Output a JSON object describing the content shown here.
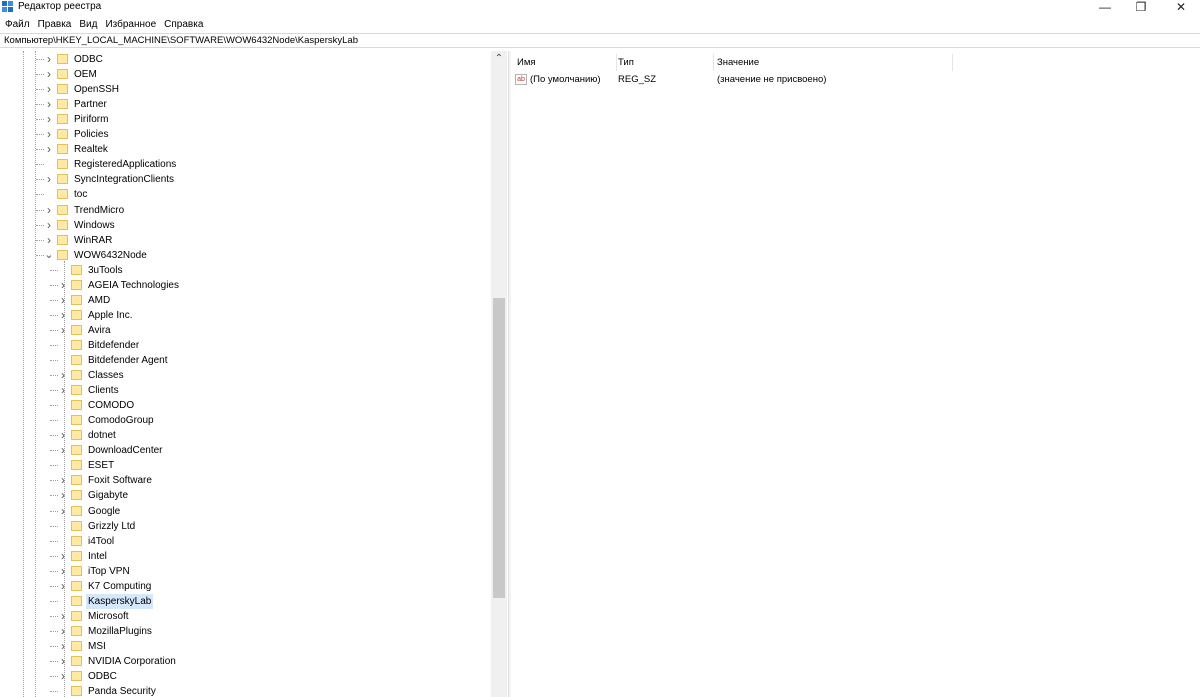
{
  "window": {
    "title": "Редактор реестра",
    "minimize_glyph": "—",
    "restore_glyph": "❐",
    "close_glyph": "✕"
  },
  "menu": [
    "Файл",
    "Правка",
    "Вид",
    "Избранное",
    "Справка"
  ],
  "address": "Компьютер\\HKEY_LOCAL_MACHINE\\SOFTWARE\\WOW6432Node\\KasperskyLab",
  "tree": [
    {
      "label": "ODBC",
      "depth": 0,
      "expander": "closed"
    },
    {
      "label": "OEM",
      "depth": 0,
      "expander": "closed"
    },
    {
      "label": "OpenSSH",
      "depth": 0,
      "expander": "closed"
    },
    {
      "label": "Partner",
      "depth": 0,
      "expander": "closed"
    },
    {
      "label": "Piriform",
      "depth": 0,
      "expander": "closed"
    },
    {
      "label": "Policies",
      "depth": 0,
      "expander": "closed"
    },
    {
      "label": "Realtek",
      "depth": 0,
      "expander": "closed"
    },
    {
      "label": "RegisteredApplications",
      "depth": 0,
      "expander": "none"
    },
    {
      "label": "SyncIntegrationClients",
      "depth": 0,
      "expander": "closed"
    },
    {
      "label": "toc",
      "depth": 0,
      "expander": "none"
    },
    {
      "label": "TrendMicro",
      "depth": 0,
      "expander": "closed"
    },
    {
      "label": "Windows",
      "depth": 0,
      "expander": "closed"
    },
    {
      "label": "WinRAR",
      "depth": 0,
      "expander": "closed"
    },
    {
      "label": "WOW6432Node",
      "depth": 0,
      "expander": "open"
    },
    {
      "label": "3uTools",
      "depth": 1,
      "expander": "none"
    },
    {
      "label": "AGEIA Technologies",
      "depth": 1,
      "expander": "closed"
    },
    {
      "label": "AMD",
      "depth": 1,
      "expander": "closed"
    },
    {
      "label": "Apple Inc.",
      "depth": 1,
      "expander": "closed"
    },
    {
      "label": "Avira",
      "depth": 1,
      "expander": "closed"
    },
    {
      "label": "Bitdefender",
      "depth": 1,
      "expander": "none"
    },
    {
      "label": "Bitdefender Agent",
      "depth": 1,
      "expander": "none"
    },
    {
      "label": "Classes",
      "depth": 1,
      "expander": "closed"
    },
    {
      "label": "Clients",
      "depth": 1,
      "expander": "closed"
    },
    {
      "label": "COMODO",
      "depth": 1,
      "expander": "none"
    },
    {
      "label": "ComodoGroup",
      "depth": 1,
      "expander": "none"
    },
    {
      "label": "dotnet",
      "depth": 1,
      "expander": "closed"
    },
    {
      "label": "DownloadCenter",
      "depth": 1,
      "expander": "closed"
    },
    {
      "label": "ESET",
      "depth": 1,
      "expander": "none"
    },
    {
      "label": "Foxit Software",
      "depth": 1,
      "expander": "closed"
    },
    {
      "label": "Gigabyte",
      "depth": 1,
      "expander": "closed"
    },
    {
      "label": "Google",
      "depth": 1,
      "expander": "closed"
    },
    {
      "label": "Grizzly Ltd",
      "depth": 1,
      "expander": "none"
    },
    {
      "label": "i4Tool",
      "depth": 1,
      "expander": "none"
    },
    {
      "label": "Intel",
      "depth": 1,
      "expander": "closed"
    },
    {
      "label": "iTop VPN",
      "depth": 1,
      "expander": "closed"
    },
    {
      "label": "K7 Computing",
      "depth": 1,
      "expander": "closed"
    },
    {
      "label": "KasperskyLab",
      "depth": 1,
      "expander": "none",
      "selected": true
    },
    {
      "label": "Microsoft",
      "depth": 1,
      "expander": "closed"
    },
    {
      "label": "MozillaPlugins",
      "depth": 1,
      "expander": "closed"
    },
    {
      "label": "MSI",
      "depth": 1,
      "expander": "closed"
    },
    {
      "label": "NVIDIA Corporation",
      "depth": 1,
      "expander": "closed"
    },
    {
      "label": "ODBC",
      "depth": 1,
      "expander": "closed"
    },
    {
      "label": "Panda Security",
      "depth": 1,
      "expander": "none"
    }
  ],
  "values_pane": {
    "columns": {
      "name": "Имя",
      "type": "Тип",
      "data": "Значение"
    },
    "rows": [
      {
        "icon": "ab",
        "name": "(По умолчанию)",
        "type": "REG_SZ",
        "data": "(значение не присвоено)"
      }
    ]
  },
  "scrollbar": {
    "up_glyph": "⌃"
  }
}
